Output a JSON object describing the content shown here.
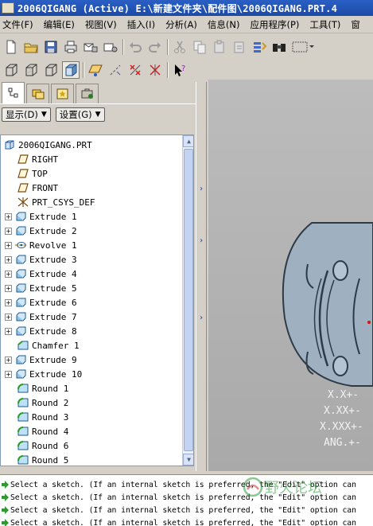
{
  "window": {
    "title": "2006QIGANG (Active) E:\\新建文件夹\\配件图\\2006QIGANG.PRT.4"
  },
  "menubar": [
    "文件(F)",
    "编辑(E)",
    "视图(V)",
    "插入(I)",
    "分析(A)",
    "信息(N)",
    "应用程序(P)",
    "工具(T)",
    "窗"
  ],
  "panel": {
    "show_label": "显示(D)",
    "settings_label": "设置(G)"
  },
  "tree": {
    "items": [
      {
        "label": "2006QIGANG.PRT",
        "icon": "part-icon",
        "expander": false
      },
      {
        "label": "RIGHT",
        "icon": "datum-plane-icon",
        "expander": false
      },
      {
        "label": "TOP",
        "icon": "datum-plane-icon",
        "expander": false
      },
      {
        "label": "FRONT",
        "icon": "datum-plane-icon",
        "expander": false
      },
      {
        "label": "PRT_CSYS_DEF",
        "icon": "csys-icon",
        "expander": false
      },
      {
        "label": "Extrude 1",
        "icon": "extrude-icon",
        "expander": true
      },
      {
        "label": "Extrude 2",
        "icon": "extrude-icon",
        "expander": true
      },
      {
        "label": "Revolve 1",
        "icon": "revolve-icon",
        "expander": true
      },
      {
        "label": "Extrude 3",
        "icon": "extrude-icon",
        "expander": true
      },
      {
        "label": "Extrude 4",
        "icon": "extrude-icon",
        "expander": true
      },
      {
        "label": "Extrude 5",
        "icon": "extrude-icon",
        "expander": true
      },
      {
        "label": "Extrude 6",
        "icon": "extrude-icon",
        "expander": true
      },
      {
        "label": "Extrude 7",
        "icon": "extrude-icon",
        "expander": true
      },
      {
        "label": "Extrude 8",
        "icon": "extrude-icon",
        "expander": true
      },
      {
        "label": "Chamfer 1",
        "icon": "chamfer-icon",
        "expander": false
      },
      {
        "label": "Extrude 9",
        "icon": "extrude-icon",
        "expander": true
      },
      {
        "label": "Extrude 10",
        "icon": "extrude-icon",
        "expander": true
      },
      {
        "label": "Round 1",
        "icon": "round-icon",
        "expander": false
      },
      {
        "label": "Round 2",
        "icon": "round-icon",
        "expander": false
      },
      {
        "label": "Round 3",
        "icon": "round-icon",
        "expander": false
      },
      {
        "label": "Round 4",
        "icon": "round-icon",
        "expander": false
      },
      {
        "label": "Round 6",
        "icon": "round-icon",
        "expander": false
      },
      {
        "label": "Round 5",
        "icon": "round-icon",
        "expander": false
      }
    ]
  },
  "graphics": {
    "tolerance_lines": [
      "X.X+-",
      "X.XX+-",
      "X.XXX+-",
      "ANG.+-"
    ]
  },
  "messages": [
    "Select a sketch. (If an internal sketch is preferred, the \"Edit\" option can",
    "Select a sketch. (If an internal sketch is preferred, the \"Edit\" option can",
    "Select a sketch. (If an internal sketch is preferred, the \"Edit\" option can",
    "Select a sketch. (If an internal sketch is preferred, the \"Edit\" option can"
  ],
  "watermark": "野火论坛",
  "colors": {
    "titlebar": "#2056bd",
    "model_fill": "#9fb0c0",
    "model_edge": "#2d3a48",
    "message_arrow": "#2c9a2c"
  }
}
